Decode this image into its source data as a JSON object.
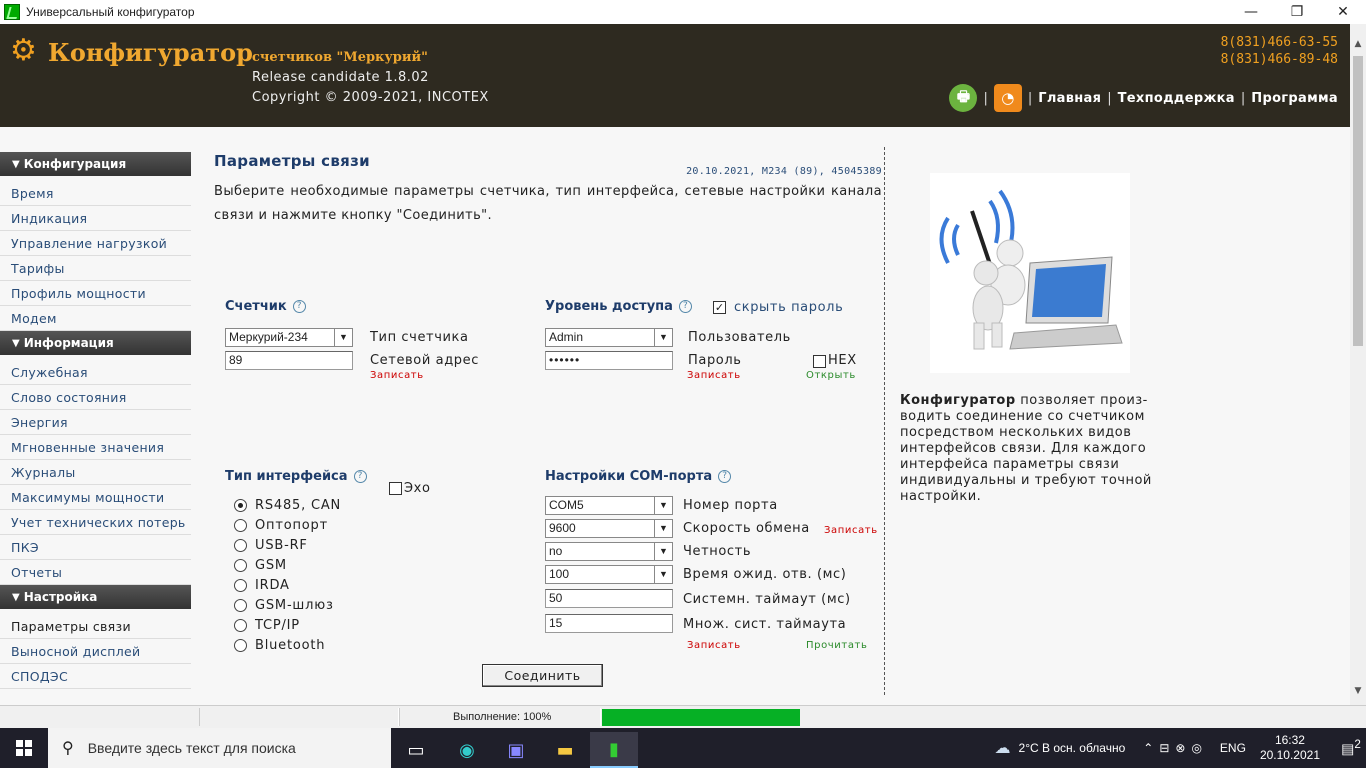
{
  "window": {
    "title": "Универсальный конфигуратор",
    "minimize": "—",
    "maximize": "❐",
    "close": "✕"
  },
  "header": {
    "logo_title": "Конфигуратор",
    "logo_sub": "счетчиков \"Меркурий\"",
    "release": "Release candidate 1.8.02",
    "copyright": "Copyright © 2009-2021, INCOTEX",
    "phone1": "8(831)466-63-55",
    "phone2": "8(831)466-89-48",
    "nav": [
      "Главная",
      "Техподдержка",
      "Программа"
    ],
    "separator": "|"
  },
  "sidebar": {
    "sections": [
      {
        "title": "Конфигурация",
        "items": [
          "Время",
          "Индикация",
          "Управление нагрузкой",
          "Тарифы",
          "Профиль мощности",
          "Модем"
        ]
      },
      {
        "title": "Информация",
        "items": [
          "Служебная",
          "Слово состояния",
          "Энергия",
          "Мгновенные значения",
          "Журналы",
          "Максимумы мощности",
          "Учет технических потерь",
          "ПКЭ",
          "Отчеты"
        ]
      },
      {
        "title": "Настройка",
        "items": [
          "Параметры связи",
          "Выносной дисплей",
          "СПОДЭС"
        ]
      }
    ]
  },
  "main": {
    "title": "Параметры связи",
    "meta": "20.10.2021, M234 (89), 45045389",
    "intro": "Выберите необходимые параметры счетчика, тип интерфейса, сетевые настройки канала связи и нажмите кнопку \"Соединить\".",
    "meter": {
      "title": "Счетчик",
      "type_value": "Меркурий-234",
      "type_label": "Тип счетчика",
      "address_value": "89",
      "address_label": "Сетевой адрес",
      "write": "Записать"
    },
    "access": {
      "title": "Уровень доступа",
      "hide_password": "скрыть пароль",
      "user_value": "Admin",
      "user_label": "Пользователь",
      "password_value": "••••••",
      "password_label": "Пароль",
      "hex_label": "HEX",
      "write": "Записать",
      "open": "Открыть"
    },
    "interface": {
      "title": "Тип интерфейса",
      "echo_label": "Эхо",
      "options": [
        "RS485, CAN",
        "Оптопорт",
        "USB-RF",
        "GSM",
        "IRDA",
        "GSM-шлюз",
        "TCP/IP",
        "Bluetooth"
      ],
      "selected_index": 0
    },
    "com": {
      "title": "Настройки COM-порта",
      "port_value": "COM5",
      "port_label": "Номер порта",
      "baud_value": "9600",
      "baud_label": "Скорость обмена",
      "baud_write": "Записать",
      "parity_value": "no",
      "parity_label": "Четность",
      "timeout_value": "100",
      "timeout_label": "Время ожид. отв. (мс)",
      "sys_timeout_value": "50",
      "sys_timeout_label": "Системн. таймаут (мс)",
      "mult_value": "15",
      "mult_label": "Множ. сист. таймаута",
      "write": "Записать",
      "read": "Прочитать"
    },
    "connect_button": "Соединить"
  },
  "right": {
    "desc_bold": "Конфигуратор",
    "desc_rest": " позволяет произ-водить соединение со счетчиком посредством нескольких видов интерфейсов связи. Для каждого интерфейса параметры связи индивидуальны и требуют точной настройки."
  },
  "statusbar": {
    "progress_text": "Выполнение: 100%",
    "progress": 1.0
  },
  "taskbar": {
    "search_placeholder": "Введите здесь текст для поиска",
    "weather": "2°C  В осн. облачно",
    "lang": "ENG",
    "time": "16:32",
    "date": "20.10.2021",
    "notifications": "2"
  },
  "colors": {
    "header_bg": "#2e2a20",
    "brand_orange": "#f0a830",
    "link_blue": "#2a4d78",
    "progress_green": "#06b025"
  }
}
